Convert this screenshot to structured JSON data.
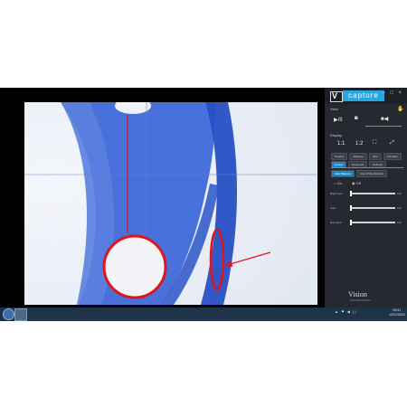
{
  "panel": {
    "logo_letter": "V",
    "brand": "capture",
    "window_controls": "– □ ×",
    "view_label": "View",
    "display_label": "Display",
    "play_label": "▶/II",
    "zoom_1": "1:1",
    "zoom_2": "1:2",
    "tabs_row1": [
      "Overlay",
      "Measure",
      "Grid",
      "Annotate"
    ],
    "tabs_row2": [
      "Colour",
      "Focus Aid",
      "Settings"
    ],
    "tabs_row3": [
      "Auto Balance",
      "Auto White Balance"
    ],
    "radio_1": "On",
    "radio_2": "Off",
    "sliders": [
      {
        "label": "Brightness",
        "value_text": "100"
      },
      {
        "label": "Gain",
        "value_text": "100"
      },
      {
        "label": "Exposure",
        "value_text": "100"
      }
    ],
    "vision_logo": "Vision",
    "vision_sub": "ENGINEERING"
  },
  "taskbar": {
    "tray_icons": "▲ ⚑ ◀ ))",
    "time": "09:41",
    "date": "12/12/2016"
  },
  "colors": {
    "stain_blue": "#2f5fd6",
    "annotation_red": "#e0141c",
    "panel_bg": "#262a30",
    "brand_blue": "#2aa7e0"
  }
}
